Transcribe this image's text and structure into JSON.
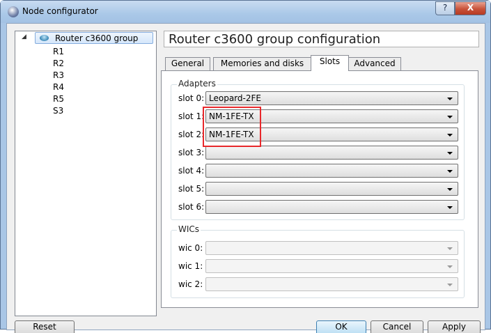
{
  "window": {
    "title": "Node configurator",
    "help_label": "?",
    "close_label": "X"
  },
  "tree": {
    "root": "Router c3600 group",
    "children": [
      "R1",
      "R2",
      "R3",
      "R4",
      "R5",
      "S3"
    ]
  },
  "header": {
    "title": "Router c3600 group configuration"
  },
  "tabs": [
    {
      "label": "General"
    },
    {
      "label": "Memories and disks"
    },
    {
      "label": "Slots",
      "active": true
    },
    {
      "label": "Advanced"
    }
  ],
  "adapters": {
    "title": "Adapters",
    "slots": [
      {
        "label": "slot 0:",
        "value": "Leopard-2FE"
      },
      {
        "label": "slot 1:",
        "value": "NM-1FE-TX"
      },
      {
        "label": "slot 2:",
        "value": "NM-1FE-TX"
      },
      {
        "label": "slot 3:",
        "value": ""
      },
      {
        "label": "slot 4:",
        "value": ""
      },
      {
        "label": "slot 5:",
        "value": ""
      },
      {
        "label": "slot 6:",
        "value": ""
      }
    ]
  },
  "wics": {
    "title": "WICs",
    "slots": [
      {
        "label": "wic 0:",
        "value": ""
      },
      {
        "label": "wic 1:",
        "value": ""
      },
      {
        "label": "wic 2:",
        "value": ""
      }
    ]
  },
  "buttons": {
    "reset": "Reset",
    "ok": "OK",
    "cancel": "Cancel",
    "apply": "Apply"
  },
  "colors": {
    "highlight": "#e8282b",
    "selection": "#d5e7fb"
  },
  "icons": {
    "app": "network-node-icon",
    "root": "router-icon",
    "expander": "triangle-expanded-icon",
    "dropdown": "chevron-down-icon"
  }
}
